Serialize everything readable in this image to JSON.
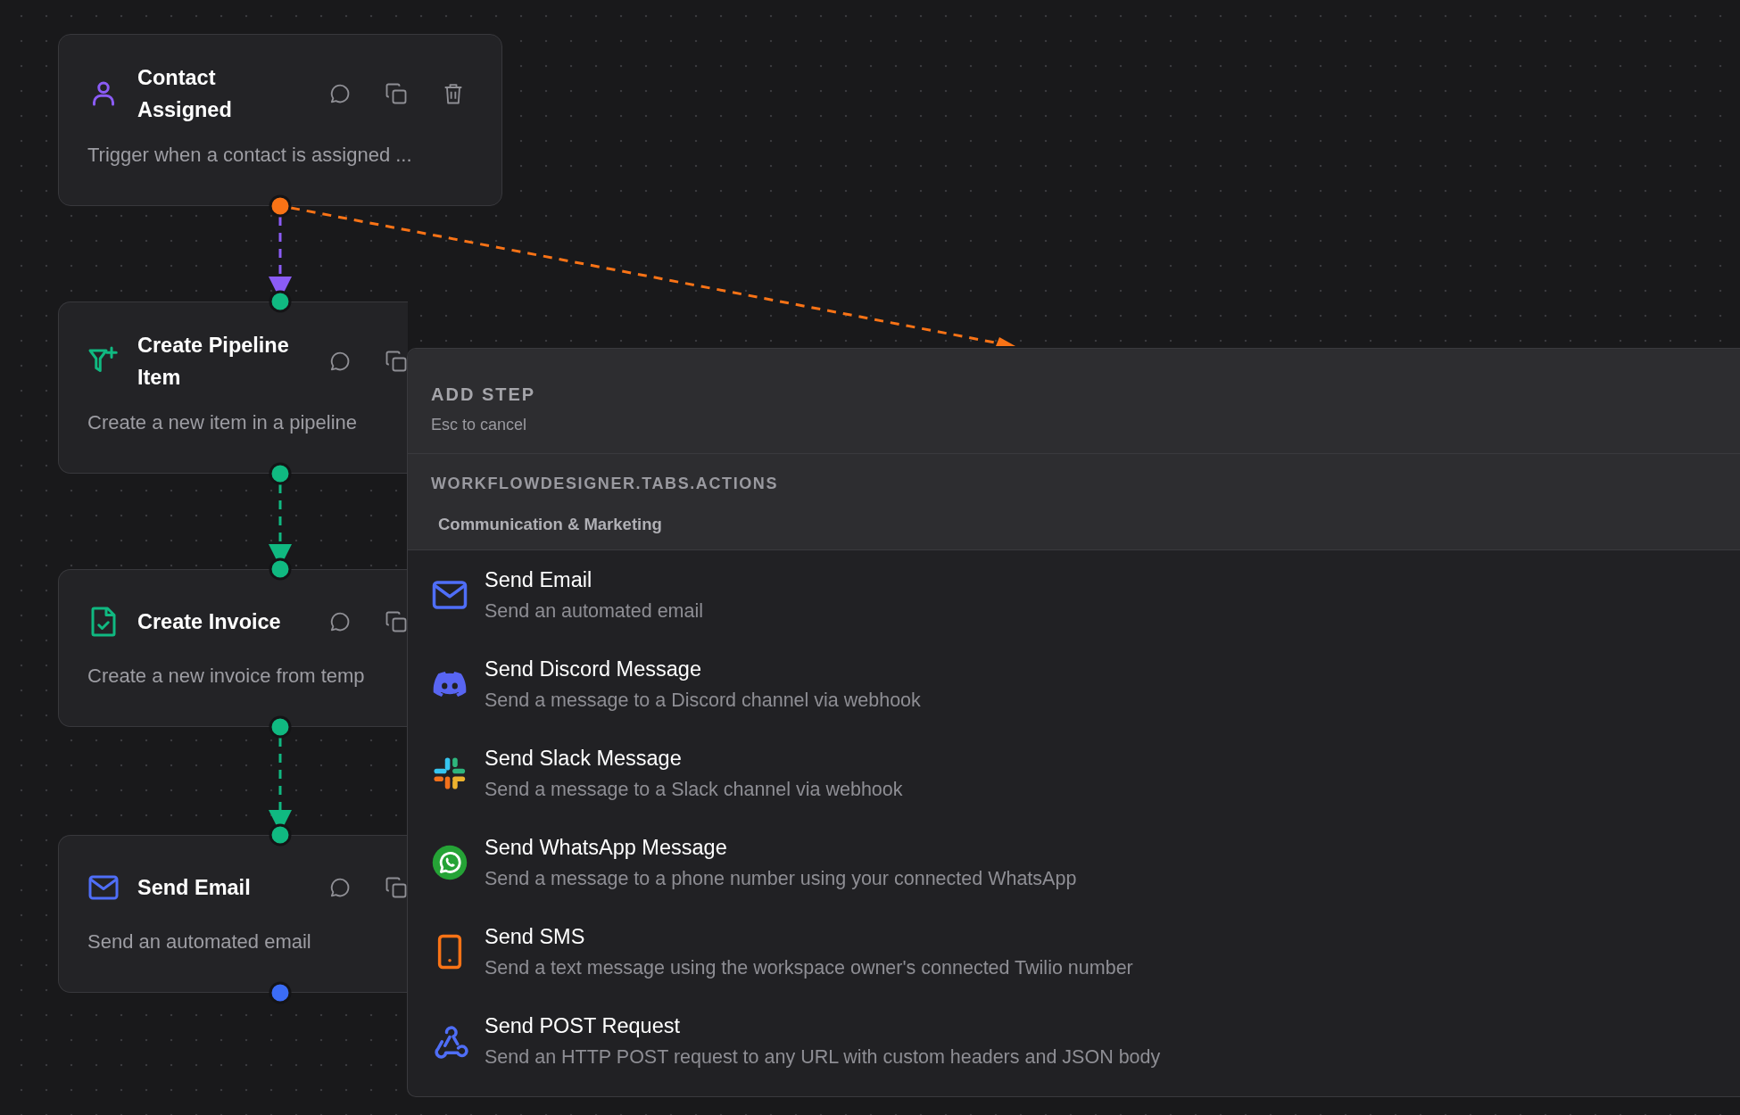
{
  "nodes": [
    {
      "title": "Contact Assigned",
      "description": "Trigger when a contact is assigned ...",
      "color": "#8b5cf6"
    },
    {
      "title": "Create Pipeline Item",
      "description": "Create a new item in a pipeline",
      "color": "#10b981"
    },
    {
      "title": "Create Invoice",
      "description": "Create a new invoice from temp",
      "color": "#10b981"
    },
    {
      "title": "Send Email",
      "description": "Send an automated email",
      "color": "#4f6ef7"
    }
  ],
  "handles": [
    {
      "color": "#f97316"
    },
    {
      "color": "#10b981"
    },
    {
      "color": "#10b981"
    },
    {
      "color": "#10b981"
    },
    {
      "color": "#10b981"
    },
    {
      "color": "#10b981"
    },
    {
      "color": "#3b6cf5"
    }
  ],
  "edges": [
    {
      "kind": "chain",
      "color": "#8b5cf6"
    },
    {
      "kind": "branch",
      "color": "#f97316"
    },
    {
      "kind": "chain",
      "color": "#10b981"
    },
    {
      "kind": "chain",
      "color": "#10b981"
    }
  ],
  "add_step": {
    "title": "ADD STEP",
    "hint": "Esc to cancel",
    "section": "WORKFLOWDESIGNER.TABS.ACTIONS",
    "category": "Communication & Marketing",
    "items": [
      {
        "title": "Send Email",
        "description": "Send an automated email"
      },
      {
        "title": "Send Discord Message",
        "description": "Send a message to a Discord channel via webhook"
      },
      {
        "title": "Send Slack Message",
        "description": "Send a message to a Slack channel via webhook"
      },
      {
        "title": "Send WhatsApp Message",
        "description": "Send a message to a phone number using your connected WhatsApp"
      },
      {
        "title": "Send SMS",
        "description": "Send a text message using the workspace owner's connected Twilio number"
      },
      {
        "title": "Send POST Request",
        "description": "Send an HTTP POST request to any URL with custom headers and JSON body"
      }
    ]
  }
}
